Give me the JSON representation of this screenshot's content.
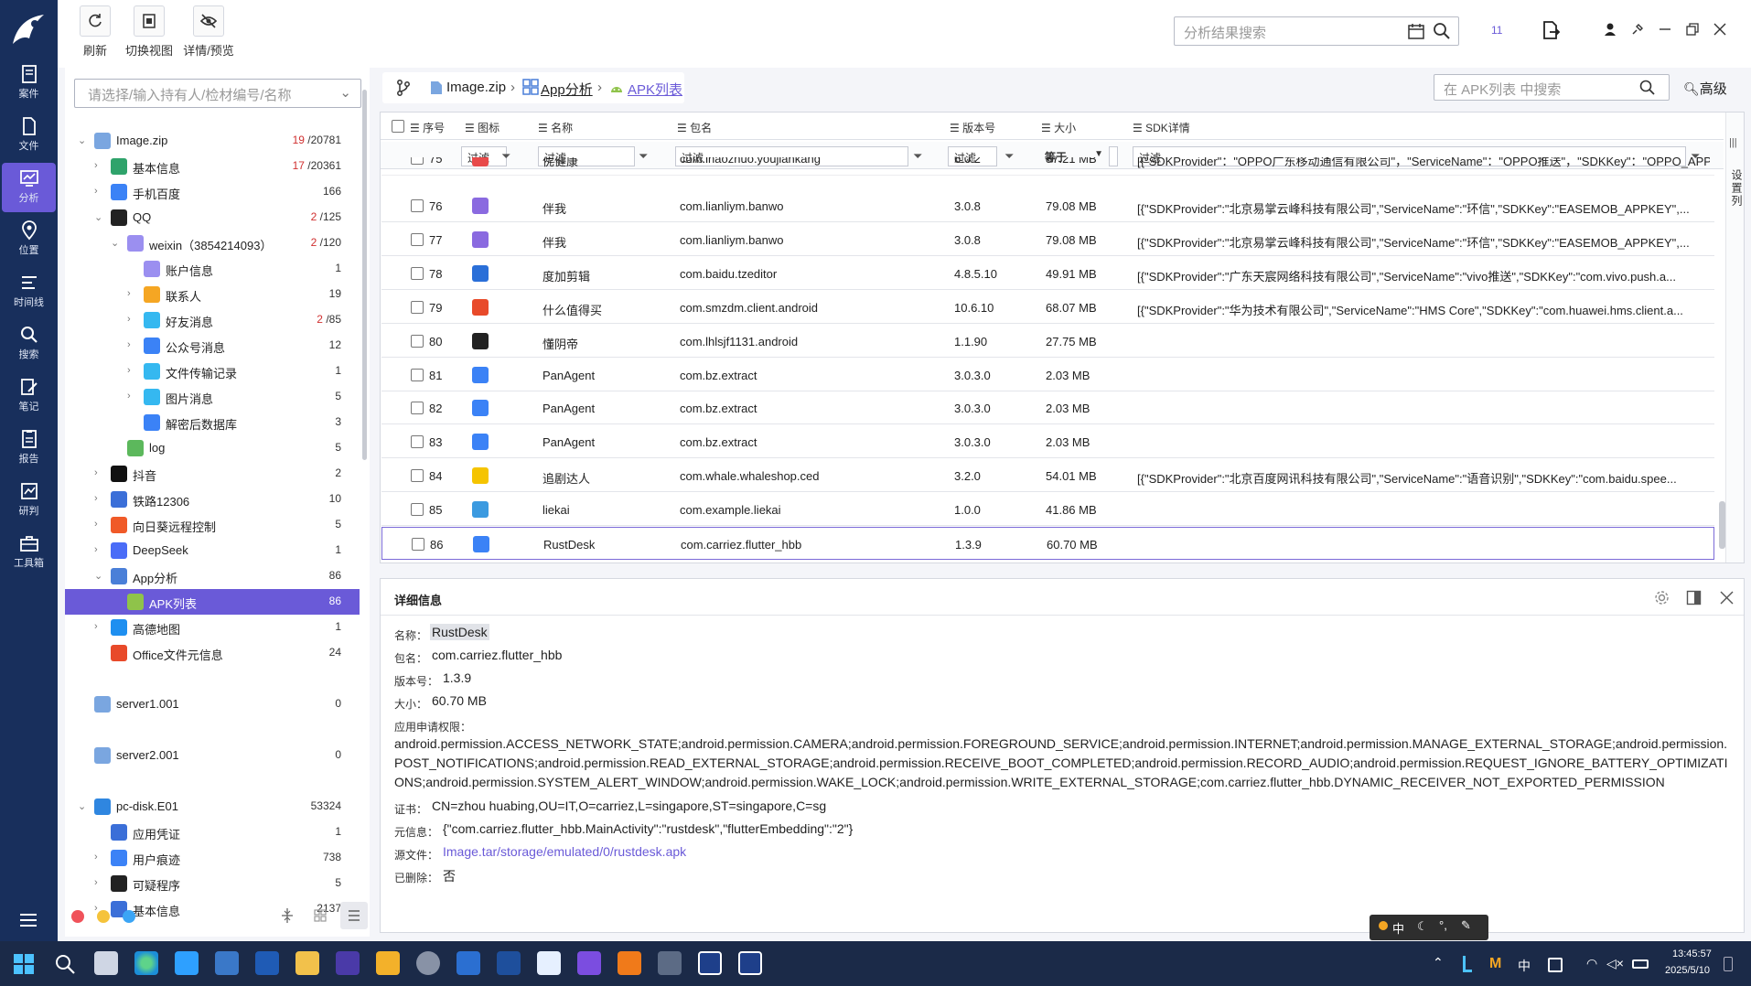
{
  "toolbar": {
    "refresh": "刷新",
    "switch_view": "切换视图",
    "detail_preview": "详情/预览"
  },
  "global_search": {
    "placeholder": "分析结果搜索"
  },
  "window": {
    "badge": "11"
  },
  "nav": {
    "items": [
      "案件",
      "文件",
      "分析",
      "位置",
      "时间线",
      "搜索",
      "笔记",
      "报告",
      "研判",
      "工具箱"
    ]
  },
  "holder": {
    "placeholder": "请选择/输入持有人/检材编号/名称"
  },
  "tree": [
    {
      "label": "Image.zip",
      "count_red": "19",
      "count": "/20781"
    },
    {
      "label": "基本信息",
      "count_red": "17",
      "count": "/20361"
    },
    {
      "label": "手机百度",
      "count": "166"
    },
    {
      "label": "QQ",
      "count_red": "2",
      "count": "/125"
    },
    {
      "label": "weixin（3854214093）",
      "count_red": "2",
      "count": "/120"
    },
    {
      "label": "账户信息",
      "count": "1"
    },
    {
      "label": "联系人",
      "count": "19"
    },
    {
      "label": "好友消息",
      "count_red": "2",
      "count": "/85"
    },
    {
      "label": "公众号消息",
      "count": "12"
    },
    {
      "label": "文件传输记录",
      "count": "1"
    },
    {
      "label": "图片消息",
      "count": "5"
    },
    {
      "label": "解密后数据库",
      "count": "3"
    },
    {
      "label": "log",
      "count": "5"
    },
    {
      "label": "抖音",
      "count": "2"
    },
    {
      "label": "铁路12306",
      "count": "10"
    },
    {
      "label": "向日葵远程控制",
      "count": "5"
    },
    {
      "label": "DeepSeek",
      "count": "1"
    },
    {
      "label": "App分析",
      "count": "86"
    },
    {
      "label": "APK列表",
      "count": "86"
    },
    {
      "label": "高德地图",
      "count": "1"
    },
    {
      "label": "Office文件元信息",
      "count": "24"
    },
    {
      "label": "server1.001",
      "count": "0"
    },
    {
      "label": "server2.001",
      "count": "0"
    },
    {
      "label": "pc-disk.E01",
      "count": "53324"
    },
    {
      "label": "应用凭证",
      "count": "1"
    },
    {
      "label": "用户痕迹",
      "count": "738"
    },
    {
      "label": "可疑程序",
      "count": "5"
    },
    {
      "label": "基本信息",
      "count": "2137"
    }
  ],
  "breadcrumb": {
    "root": "Image.zip",
    "mid": "App分析",
    "current": "APK列表"
  },
  "apk_search": {
    "placeholder": "在 APK列表 中搜索"
  },
  "advanced": "高级",
  "columns": {
    "seq": "序号",
    "icon": "图标",
    "name": "名称",
    "pkg": "包名",
    "ver": "版本号",
    "size": "大小",
    "sdk": "SDK详情"
  },
  "filter": {
    "text": "过滤",
    "eq": "等于"
  },
  "rows": [
    {
      "seq": "75",
      "name": "优健康",
      "pkg": "com.ihaozhuo.youjiankang",
      "ver": "6.0.2",
      "size": "87.21 MB",
      "sdk": "[{\"SDKProvider\"：\"OPPO广东移动通信有限公司\"，\"ServiceName\"：\"OPPO推送\"，\"SDKKey\"：\"OPPO_APPKE..."
    },
    {
      "seq": "76",
      "name": "伴我",
      "pkg": "com.lianliym.banwo",
      "ver": "3.0.8",
      "size": "79.08 MB",
      "sdk": "[{\"SDKProvider\":\"北京易掌云峰科技有限公司\",\"ServiceName\":\"环信\",\"SDKKey\":\"EASEMOB_APPKEY\",..."
    },
    {
      "seq": "77",
      "name": "伴我",
      "pkg": "com.lianliym.banwo",
      "ver": "3.0.8",
      "size": "79.08 MB",
      "sdk": "[{\"SDKProvider\":\"北京易掌云峰科技有限公司\",\"ServiceName\":\"环信\",\"SDKKey\":\"EASEMOB_APPKEY\",..."
    },
    {
      "seq": "78",
      "name": "度加剪辑",
      "pkg": "com.baidu.tzeditor",
      "ver": "4.8.5.10",
      "size": "49.91 MB",
      "sdk": "[{\"SDKProvider\":\"广东天宸网络科技有限公司\",\"ServiceName\":\"vivo推送\",\"SDKKey\":\"com.vivo.push.a..."
    },
    {
      "seq": "79",
      "name": "什么值得买",
      "pkg": "com.smzdm.client.android",
      "ver": "10.6.10",
      "size": "68.07 MB",
      "sdk": "[{\"SDKProvider\":\"华为技术有限公司\",\"ServiceName\":\"HMS Core\",\"SDKKey\":\"com.huawei.hms.client.a..."
    },
    {
      "seq": "80",
      "name": "懂阴帝",
      "pkg": "com.lhlsjf1131.android",
      "ver": "1.1.90",
      "size": "27.75 MB",
      "sdk": ""
    },
    {
      "seq": "81",
      "name": "PanAgent",
      "pkg": "com.bz.extract",
      "ver": "3.0.3.0",
      "size": "2.03 MB",
      "sdk": ""
    },
    {
      "seq": "82",
      "name": "PanAgent",
      "pkg": "com.bz.extract",
      "ver": "3.0.3.0",
      "size": "2.03 MB",
      "sdk": ""
    },
    {
      "seq": "83",
      "name": "PanAgent",
      "pkg": "com.bz.extract",
      "ver": "3.0.3.0",
      "size": "2.03 MB",
      "sdk": ""
    },
    {
      "seq": "84",
      "name": "追剧达人",
      "pkg": "com.whale.whaleshop.ced",
      "ver": "3.2.0",
      "size": "54.01 MB",
      "sdk": "[{\"SDKProvider\":\"北京百度网讯科技有限公司\",\"ServiceName\":\"语音识别\",\"SDKKey\":\"com.baidu.spee..."
    },
    {
      "seq": "85",
      "name": "liekai",
      "pkg": "com.example.liekai",
      "ver": "1.0.0",
      "size": "41.86 MB",
      "sdk": ""
    },
    {
      "seq": "86",
      "name": "RustDesk",
      "pkg": "com.carriez.flutter_hbb",
      "ver": "1.3.9",
      "size": "60.70 MB",
      "sdk": ""
    }
  ],
  "side_tab": "设置列",
  "detail": {
    "title": "详细信息",
    "name_label": "名称：",
    "name": "RustDesk",
    "pkg_label": "包名：",
    "pkg": "com.carriez.flutter_hbb",
    "ver_label": "版本号：",
    "ver": "1.3.9",
    "size_label": "大小：",
    "size": "60.70 MB",
    "perm_label": "应用申请权限：",
    "perm": "android.permission.ACCESS_NETWORK_STATE;android.permission.CAMERA;android.permission.FOREGROUND_SERVICE;android.permission.INTERNET;android.permission.MANAGE_EXTERNAL_STORAGE;android.permission.POST_NOTIFICATIONS;android.permission.READ_EXTERNAL_STORAGE;android.permission.RECEIVE_BOOT_COMPLETED;android.permission.RECORD_AUDIO;android.permission.REQUEST_IGNORE_BATTERY_OPTIMIZATIONS;android.permission.SYSTEM_ALERT_WINDOW;android.permission.WAKE_LOCK;android.permission.WRITE_EXTERNAL_STORAGE;com.carriez.flutter_hbb.DYNAMIC_RECEIVER_NOT_EXPORTED_PERMISSION",
    "cert_label": "证书：",
    "cert": "CN=zhou huabing,OU=IT,O=carriez,L=singapore,ST=singapore,C=sg",
    "meta_label": "元信息：",
    "meta": "{\"com.carriez.flutter_hbb.MainActivity\":\"rustdesk\",\"flutterEmbedding\":\"2\"}",
    "src_label": "源文件：",
    "src": "Image.tar/storage/emulated/0/rustdesk.apk",
    "del_label": "已删除：",
    "del": "否"
  },
  "ime": {
    "lang": "中"
  },
  "clock": {
    "time": "13:45:57",
    "date": "2025/5/10"
  },
  "colors": {
    "accent": "#6a5ad8",
    "nav_bg": "#182f5c",
    "link": "#6a5ad8",
    "taskbar": "#1b2a48"
  }
}
